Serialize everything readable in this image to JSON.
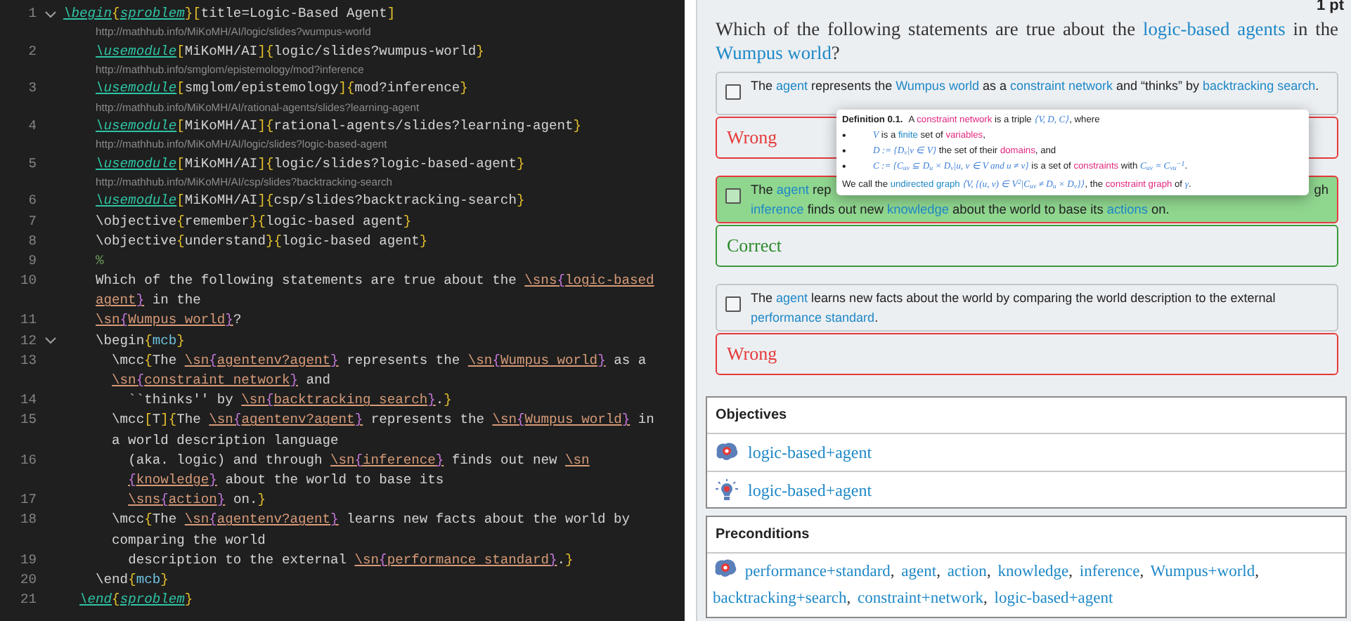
{
  "editor": {
    "lines": [
      {
        "number": "1",
        "foldable": true,
        "segments": [
          {
            "kind": "env",
            "t": "\\begin"
          },
          {
            "kind": "punct",
            "t": "{"
          },
          {
            "kind": "env",
            "t": "sproblem"
          },
          {
            "kind": "punct",
            "t": "}"
          },
          {
            "kind": "punct",
            "t": "["
          },
          {
            "kind": "plain",
            "t": "title=Logic-Based Agent"
          },
          {
            "kind": "punct",
            "t": "]"
          }
        ]
      },
      {
        "number": "2",
        "foldable": false,
        "hint": "http://mathhub.info/MiKoMH/AI/logic/slides?wumpus-world",
        "segments": [
          {
            "kind": "env",
            "t": "    \\usemodule"
          },
          {
            "kind": "punct",
            "t": "["
          },
          {
            "kind": "plain",
            "t": "MiKoMH/AI"
          },
          {
            "kind": "punct",
            "t": "]"
          },
          {
            "kind": "punct",
            "t": "{"
          },
          {
            "kind": "plain",
            "t": "logic/slides?wumpus-world"
          },
          {
            "kind": "punct",
            "t": "}"
          }
        ]
      },
      {
        "number": "3",
        "foldable": false,
        "hint": "http://mathhub.info/smglom/epistemology/mod?inference",
        "segments": [
          {
            "kind": "env",
            "t": "    \\usemodule"
          },
          {
            "kind": "punct",
            "t": "["
          },
          {
            "kind": "plain",
            "t": "smglom/epistemology"
          },
          {
            "kind": "punct",
            "t": "]"
          },
          {
            "kind": "punct",
            "t": "{"
          },
          {
            "kind": "plain",
            "t": "mod?inference"
          },
          {
            "kind": "punct",
            "t": "}"
          }
        ]
      },
      {
        "number": "4",
        "foldable": false,
        "hint": "http://mathhub.info/MiKoMH/AI/rational-agents/slides?learning-agent",
        "segments": [
          {
            "kind": "env",
            "t": "    \\usemodule"
          },
          {
            "kind": "punct",
            "t": "["
          },
          {
            "kind": "plain",
            "t": "MiKoMH/AI"
          },
          {
            "kind": "punct",
            "t": "]"
          },
          {
            "kind": "punct",
            "t": "{"
          },
          {
            "kind": "plain",
            "t": "rational-agents/slides?learning-agent"
          },
          {
            "kind": "punct",
            "t": "}"
          }
        ]
      },
      {
        "number": "5",
        "foldable": false,
        "hint": "http://mathhub.info/MiKoMH/AI/logic/slides?logic-based-agent",
        "segments": [
          {
            "kind": "env",
            "t": "    \\usemodule"
          },
          {
            "kind": "punct",
            "t": "["
          },
          {
            "kind": "plain",
            "t": "MiKoMH/AI"
          },
          {
            "kind": "punct",
            "t": "]"
          },
          {
            "kind": "punct",
            "t": "{"
          },
          {
            "kind": "plain",
            "t": "logic/slides?logic-based-agent"
          },
          {
            "kind": "punct",
            "t": "}"
          }
        ]
      },
      {
        "number": "6",
        "foldable": false,
        "hint": "http://mathhub.info/MiKoMH/AI/csp/slides?backtracking-search",
        "segments": [
          {
            "kind": "env",
            "t": "    \\usemodule"
          },
          {
            "kind": "punct",
            "t": "["
          },
          {
            "kind": "plain",
            "t": "MiKoMH/AI"
          },
          {
            "kind": "punct",
            "t": "]"
          },
          {
            "kind": "punct",
            "t": "{"
          },
          {
            "kind": "plain",
            "t": "csp/slides?backtracking-search"
          },
          {
            "kind": "punct",
            "t": "}"
          }
        ]
      },
      {
        "number": "7",
        "foldable": false,
        "segments": [
          {
            "kind": "plain",
            "t": "    \\objective"
          },
          {
            "kind": "punct",
            "t": "{"
          },
          {
            "kind": "plain",
            "t": "remember"
          },
          {
            "kind": "punct",
            "t": "}"
          },
          {
            "kind": "punct",
            "t": "{"
          },
          {
            "kind": "plain",
            "t": "logic-based agent"
          },
          {
            "kind": "punct",
            "t": "}"
          }
        ]
      },
      {
        "number": "8",
        "foldable": false,
        "segments": [
          {
            "kind": "plain",
            "t": "    \\objective"
          },
          {
            "kind": "punct",
            "t": "{"
          },
          {
            "kind": "plain",
            "t": "understand"
          },
          {
            "kind": "punct",
            "t": "}"
          },
          {
            "kind": "punct",
            "t": "{"
          },
          {
            "kind": "plain",
            "t": "logic-based agent"
          },
          {
            "kind": "punct",
            "t": "}"
          }
        ]
      },
      {
        "number": "9",
        "foldable": false,
        "segments": [
          {
            "kind": "comment",
            "t": "    %"
          }
        ]
      },
      {
        "number": "10",
        "foldable": false,
        "segments": [
          {
            "kind": "plain",
            "t": "    Which of the following statements are true about the "
          },
          {
            "kind": "ref",
            "t": "\\sns"
          },
          {
            "kind": "refbrace",
            "t": "{"
          },
          {
            "kind": "ref",
            "t": "logic-based"
          },
          {
            "kind": "wrap"
          },
          {
            "kind": "ref",
            "t": "    agent"
          },
          {
            "kind": "refbrace",
            "t": "}"
          },
          {
            "kind": "plain",
            "t": " in the"
          }
        ]
      },
      {
        "number": "11",
        "foldable": false,
        "segments": [
          {
            "kind": "ref",
            "t": "    \\sn"
          },
          {
            "kind": "refbrace",
            "t": "{"
          },
          {
            "kind": "ref",
            "t": "Wumpus world"
          },
          {
            "kind": "refbrace",
            "t": "}"
          },
          {
            "kind": "plain",
            "t": "?"
          }
        ]
      },
      {
        "number": "12",
        "foldable": true,
        "segments": [
          {
            "kind": "plain",
            "t": "    \\begin"
          },
          {
            "kind": "punct",
            "t": "{"
          },
          {
            "kind": "envname",
            "t": "mcb"
          },
          {
            "kind": "punct",
            "t": "}"
          }
        ]
      },
      {
        "number": "13",
        "foldable": false,
        "segments": [
          {
            "kind": "plain",
            "t": "      \\mcc"
          },
          {
            "kind": "punct",
            "t": "{"
          },
          {
            "kind": "plain",
            "t": "The "
          },
          {
            "kind": "ref",
            "t": "\\sn"
          },
          {
            "kind": "refbrace",
            "t": "{"
          },
          {
            "kind": "ref",
            "t": "agentenv?agent"
          },
          {
            "kind": "refbrace",
            "t": "}"
          },
          {
            "kind": "plain",
            "t": " represents the "
          },
          {
            "kind": "ref",
            "t": "\\sn"
          },
          {
            "kind": "refbrace",
            "t": "{"
          },
          {
            "kind": "ref",
            "t": "Wumpus world"
          },
          {
            "kind": "refbrace",
            "t": "}"
          },
          {
            "kind": "plain",
            "t": " as a"
          },
          {
            "kind": "wrap"
          },
          {
            "kind": "ref",
            "t": "      \\sn"
          },
          {
            "kind": "refbrace",
            "t": "{"
          },
          {
            "kind": "ref",
            "t": "constraint network"
          },
          {
            "kind": "refbrace",
            "t": "}"
          },
          {
            "kind": "plain",
            "t": " and"
          }
        ]
      },
      {
        "number": "14",
        "foldable": false,
        "segments": [
          {
            "kind": "plain",
            "t": "        ``thinks'' by "
          },
          {
            "kind": "ref",
            "t": "\\sn"
          },
          {
            "kind": "refbrace",
            "t": "{"
          },
          {
            "kind": "ref",
            "t": "backtracking search"
          },
          {
            "kind": "refbrace",
            "t": "}"
          },
          {
            "kind": "plain",
            "t": "."
          },
          {
            "kind": "punct",
            "t": "}"
          }
        ]
      },
      {
        "number": "15",
        "foldable": false,
        "segments": [
          {
            "kind": "plain",
            "t": "      \\mcc"
          },
          {
            "kind": "punct",
            "t": "["
          },
          {
            "kind": "plain",
            "t": "T"
          },
          {
            "kind": "punct",
            "t": "]"
          },
          {
            "kind": "punct",
            "t": "{"
          },
          {
            "kind": "plain",
            "t": "The "
          },
          {
            "kind": "ref",
            "t": "\\sn"
          },
          {
            "kind": "refbrace",
            "t": "{"
          },
          {
            "kind": "ref",
            "t": "agentenv?agent"
          },
          {
            "kind": "refbrace",
            "t": "}"
          },
          {
            "kind": "plain",
            "t": " represents the "
          },
          {
            "kind": "ref",
            "t": "\\sn"
          },
          {
            "kind": "refbrace",
            "t": "{"
          },
          {
            "kind": "ref",
            "t": "Wumpus world"
          },
          {
            "kind": "refbrace",
            "t": "}"
          },
          {
            "kind": "plain",
            "t": " in"
          },
          {
            "kind": "wrap"
          },
          {
            "kind": "plain",
            "t": "      a world description language"
          }
        ]
      },
      {
        "number": "16",
        "foldable": false,
        "segments": [
          {
            "kind": "plain",
            "t": "        (aka. logic) and through "
          },
          {
            "kind": "ref",
            "t": "\\sn"
          },
          {
            "kind": "refbrace",
            "t": "{"
          },
          {
            "kind": "ref",
            "t": "inference"
          },
          {
            "kind": "refbrace",
            "t": "}"
          },
          {
            "kind": "plain",
            "t": " finds out new "
          },
          {
            "kind": "ref",
            "t": "\\sn"
          },
          {
            "kind": "wrap"
          },
          {
            "kind": "refbrace",
            "t": "        {"
          },
          {
            "kind": "ref",
            "t": "knowledge"
          },
          {
            "kind": "refbrace",
            "t": "}"
          },
          {
            "kind": "plain",
            "t": " about the world to base its"
          }
        ]
      },
      {
        "number": "17",
        "foldable": false,
        "segments": [
          {
            "kind": "ref",
            "t": "        \\sns"
          },
          {
            "kind": "refbrace",
            "t": "{"
          },
          {
            "kind": "ref",
            "t": "action"
          },
          {
            "kind": "refbrace",
            "t": "}"
          },
          {
            "kind": "plain",
            "t": " on."
          },
          {
            "kind": "punct",
            "t": "}"
          }
        ]
      },
      {
        "number": "18",
        "foldable": false,
        "segments": [
          {
            "kind": "plain",
            "t": "      \\mcc"
          },
          {
            "kind": "punct",
            "t": "{"
          },
          {
            "kind": "plain",
            "t": "The "
          },
          {
            "kind": "ref",
            "t": "\\sn"
          },
          {
            "kind": "refbrace",
            "t": "{"
          },
          {
            "kind": "ref",
            "t": "agentenv?agent"
          },
          {
            "kind": "refbrace",
            "t": "}"
          },
          {
            "kind": "plain",
            "t": " learns new facts about the world by"
          },
          {
            "kind": "wrap"
          },
          {
            "kind": "plain",
            "t": "      comparing the world"
          }
        ]
      },
      {
        "number": "19",
        "foldable": false,
        "segments": [
          {
            "kind": "plain",
            "t": "        description to the external "
          },
          {
            "kind": "ref",
            "t": "\\sn"
          },
          {
            "kind": "refbrace",
            "t": "{"
          },
          {
            "kind": "ref",
            "t": "performance standard"
          },
          {
            "kind": "refbrace",
            "t": "}"
          },
          {
            "kind": "plain",
            "t": "."
          },
          {
            "kind": "punct",
            "t": "}"
          }
        ]
      },
      {
        "number": "20",
        "foldable": false,
        "segments": [
          {
            "kind": "plain",
            "t": "    \\end"
          },
          {
            "kind": "punct",
            "t": "{"
          },
          {
            "kind": "envname",
            "t": "mcb"
          },
          {
            "kind": "punct",
            "t": "}"
          }
        ]
      },
      {
        "number": "21",
        "foldable": false,
        "segments": [
          {
            "kind": "env",
            "t": "  \\end"
          },
          {
            "kind": "punct",
            "t": "{"
          },
          {
            "kind": "env",
            "t": "sproblem"
          },
          {
            "kind": "punct",
            "t": "}"
          }
        ]
      }
    ]
  },
  "preview": {
    "points": "1 pt",
    "question": [
      {
        "kind": "text",
        "t": "Which of the following statements are true about the "
      },
      {
        "kind": "link",
        "t": "logic-based agents"
      },
      {
        "kind": "text",
        "t": " in the "
      },
      {
        "kind": "link",
        "t": "Wumpus world"
      },
      {
        "kind": "text",
        "t": "?"
      }
    ],
    "options": [
      {
        "checked": false,
        "highlighted": false,
        "text": [
          {
            "kind": "text",
            "t": "The "
          },
          {
            "kind": "link",
            "t": "agent"
          },
          {
            "kind": "text",
            "t": " represents the "
          },
          {
            "kind": "link",
            "t": "Wumpus world"
          },
          {
            "kind": "text",
            "t": " as a "
          },
          {
            "kind": "link",
            "t": "constraint network"
          },
          {
            "kind": "text",
            "t": " and “thinks” by "
          },
          {
            "kind": "link",
            "t": "backtracking search"
          },
          {
            "kind": "text",
            "t": "."
          }
        ],
        "feedback": {
          "kind": "wrong",
          "label": "Wrong"
        }
      },
      {
        "checked": false,
        "highlighted": true,
        "text": [
          {
            "kind": "text",
            "t": "The "
          },
          {
            "kind": "link",
            "t": "agent"
          },
          {
            "kind": "text",
            "t": " rep"
          }
        ],
        "text_right": [
          {
            "kind": "text",
            "t": "gh"
          }
        ],
        "text_line2": [
          {
            "kind": "link",
            "t": "inference"
          },
          {
            "kind": "text",
            "t": " finds out new "
          },
          {
            "kind": "link",
            "t": "knowledge"
          },
          {
            "kind": "text",
            "t": " about the world to base its "
          },
          {
            "kind": "link",
            "t": "actions"
          },
          {
            "kind": "text",
            "t": " on."
          }
        ],
        "feedback": {
          "kind": "correct",
          "label": "Correct"
        }
      },
      {
        "checked": false,
        "highlighted": false,
        "text": [
          {
            "kind": "text",
            "t": "The "
          },
          {
            "kind": "link",
            "t": "agent"
          },
          {
            "kind": "text",
            "t": " learns new facts about the world by comparing the world description to the external "
          },
          {
            "kind": "link",
            "t": "performance standard"
          },
          {
            "kind": "text",
            "t": "."
          }
        ],
        "feedback": {
          "kind": "wrong",
          "label": "Wrong"
        }
      }
    ],
    "popup": {
      "heading": "Definition 0.1.",
      "bullet": "•",
      "intro": [
        {
          "kind": "text",
          "t": "A "
        },
        {
          "kind": "term",
          "t": "constraint network"
        },
        {
          "kind": "text",
          "t": " is a triple "
        },
        {
          "kind": "math",
          "t": "⟨V, D, C⟩"
        },
        {
          "kind": "text",
          "t": ", where"
        }
      ],
      "bullets": [
        [
          {
            "kind": "math",
            "t": "V"
          },
          {
            "kind": "text",
            "t": " is a "
          },
          {
            "kind": "link",
            "t": "finite"
          },
          {
            "kind": "text",
            "t": " set of "
          },
          {
            "kind": "term",
            "t": "variables"
          },
          {
            "kind": "text",
            "t": ","
          }
        ],
        [
          {
            "kind": "math",
            "t": "D := {D$_{v}$|v ∈ V}"
          },
          {
            "kind": "text",
            "t": " the set of their "
          },
          {
            "kind": "term",
            "t": "domains"
          },
          {
            "kind": "text",
            "t": ", and"
          }
        ],
        [
          {
            "kind": "math",
            "t": "C := {C$_{uv}$ ⊆ D$_{u}$ × D$_{v}$|u, v ∈ V and u ≠ v}"
          },
          {
            "kind": "text",
            "t": " is a set of "
          },
          {
            "kind": "term",
            "t": "constraints"
          },
          {
            "kind": "text",
            "t": " with "
          },
          {
            "kind": "math",
            "t": "C$_{uv}$ = C$_{vu}$$^{−1}$"
          },
          {
            "kind": "text",
            "t": "."
          }
        ]
      ],
      "closing": [
        {
          "kind": "text",
          "t": "We call the "
        },
        {
          "kind": "link",
          "t": "undirected graph"
        },
        {
          "kind": "math",
          "t": " ⟨V, {(u, v) ∈ V$^{2}$|C$_{uv}$ ≠ D$_{u}$ × D$_{v}$}⟩"
        },
        {
          "kind": "text",
          "t": ", the "
        },
        {
          "kind": "term",
          "t": "constraint graph"
        },
        {
          "kind": "text",
          "t": " of "
        },
        {
          "kind": "math",
          "t": "γ"
        },
        {
          "kind": "text",
          "t": "."
        }
      ]
    },
    "objectives": {
      "title": "Objectives",
      "items": [
        {
          "kind": "brain",
          "label": "logic-based+agent"
        },
        {
          "kind": "lightbulb",
          "label": "logic-based+agent"
        }
      ]
    },
    "preconditions": {
      "title": "Preconditions",
      "kind": "brain",
      "items": [
        {
          "label": "performance+standard",
          "sep": ","
        },
        {
          "label": "agent",
          "sep": ","
        },
        {
          "label": "action",
          "sep": ","
        },
        {
          "label": "knowledge",
          "sep": ","
        },
        {
          "label": "inference",
          "sep": ","
        },
        {
          "label": "Wumpus+world",
          "sep": ","
        },
        {
          "label": "backtracking+search",
          "sep": ","
        },
        {
          "label": "constraint+network",
          "sep": ","
        },
        {
          "label": "logic-based+agent"
        }
      ]
    }
  }
}
